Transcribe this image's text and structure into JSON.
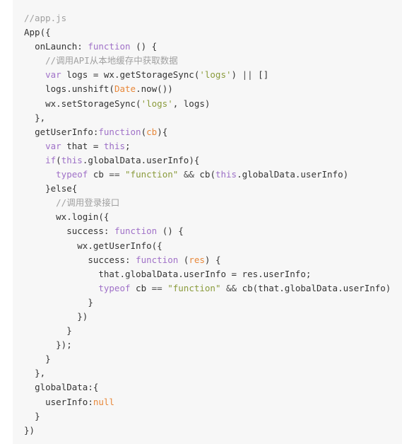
{
  "editor": {
    "language": "javascript",
    "file_name": "app.js",
    "background_color": "#f7f7f7",
    "page_background_color": "#ffffff",
    "default_text_color": "#333333",
    "colors": {
      "comment": "#a0a0a0",
      "keyword": "#a071c8",
      "this_keyword": "#9b6ec6",
      "parameter": "#e8883a",
      "builtin": "#e8883a",
      "string": "#8a9b3b",
      "null_literal": "#e8883a",
      "operator": "#4a4a4a"
    }
  },
  "code": {
    "plain_text": "//app.js\nApp({\n  onLaunch: function () {\n    //调用API从本地缓存中获取数据\n    var logs = wx.getStorageSync('logs') || []\n    logs.unshift(Date.now())\n    wx.setStorageSync('logs', logs)\n  },\n  getUserInfo:function(cb){\n    var that = this;\n    if(this.globalData.userInfo){\n      typeof cb == \"function\" && cb(this.globalData.userInfo)\n    }else{\n      //调用登录接口\n      wx.login({\n        success: function () {\n          wx.getUserInfo({\n            success: function (res) {\n              that.globalData.userInfo = res.userInfo;\n              typeof cb == \"function\" && cb(that.globalData.userInfo)\n            }\n          })\n        }\n      });\n    }\n  },\n  globalData:{\n    userInfo:null\n  }\n})",
    "lines": [
      {
        "indent": "",
        "tokens": [
          {
            "t": "//app.js",
            "c": "comment"
          }
        ]
      },
      {
        "indent": "",
        "tokens": [
          {
            "t": "App({",
            "c": "plain"
          }
        ]
      },
      {
        "indent": "  ",
        "tokens": [
          {
            "t": "onLaunch: ",
            "c": "plain"
          },
          {
            "t": "function",
            "c": "keyword"
          },
          {
            "t": " () {",
            "c": "plain"
          }
        ]
      },
      {
        "indent": "    ",
        "tokens": [
          {
            "t": "//调用API从本地缓存中获取数据",
            "c": "comment"
          }
        ]
      },
      {
        "indent": "    ",
        "tokens": [
          {
            "t": "var",
            "c": "keyword"
          },
          {
            "t": " logs = wx.getStorageSync(",
            "c": "plain"
          },
          {
            "t": "'logs'",
            "c": "string"
          },
          {
            "t": ") ",
            "c": "plain"
          },
          {
            "t": "||",
            "c": "op"
          },
          {
            "t": " []",
            "c": "plain"
          }
        ]
      },
      {
        "indent": "    ",
        "tokens": [
          {
            "t": "logs.unshift(",
            "c": "plain"
          },
          {
            "t": "Date",
            "c": "builtin"
          },
          {
            "t": ".now())",
            "c": "plain"
          }
        ]
      },
      {
        "indent": "    ",
        "tokens": [
          {
            "t": "wx.setStorageSync(",
            "c": "plain"
          },
          {
            "t": "'logs'",
            "c": "string"
          },
          {
            "t": ", logs)",
            "c": "plain"
          }
        ]
      },
      {
        "indent": "  ",
        "tokens": [
          {
            "t": "},",
            "c": "plain"
          }
        ]
      },
      {
        "indent": "  ",
        "tokens": [
          {
            "t": "getUserInfo:",
            "c": "plain"
          },
          {
            "t": "function",
            "c": "keyword"
          },
          {
            "t": "(",
            "c": "plain"
          },
          {
            "t": "cb",
            "c": "param"
          },
          {
            "t": "){",
            "c": "plain"
          }
        ]
      },
      {
        "indent": "    ",
        "tokens": [
          {
            "t": "var",
            "c": "keyword"
          },
          {
            "t": " that = ",
            "c": "plain"
          },
          {
            "t": "this",
            "c": "this"
          },
          {
            "t": ";",
            "c": "plain"
          }
        ]
      },
      {
        "indent": "    ",
        "tokens": [
          {
            "t": "if",
            "c": "keyword"
          },
          {
            "t": "(",
            "c": "plain"
          },
          {
            "t": "this",
            "c": "this"
          },
          {
            "t": ".globalData.userInfo){",
            "c": "plain"
          }
        ]
      },
      {
        "indent": "      ",
        "tokens": [
          {
            "t": "typeof",
            "c": "keyword"
          },
          {
            "t": " cb ",
            "c": "plain"
          },
          {
            "t": "==",
            "c": "op"
          },
          {
            "t": " ",
            "c": "plain"
          },
          {
            "t": "\"function\"",
            "c": "string"
          },
          {
            "t": " ",
            "c": "plain"
          },
          {
            "t": "&&",
            "c": "op"
          },
          {
            "t": " cb(",
            "c": "plain"
          },
          {
            "t": "this",
            "c": "this"
          },
          {
            "t": ".globalData.userInfo)",
            "c": "plain"
          }
        ]
      },
      {
        "indent": "    ",
        "tokens": [
          {
            "t": "}",
            "c": "plain"
          },
          {
            "t": "else",
            "c": "plain"
          },
          {
            "t": "{",
            "c": "plain"
          }
        ]
      },
      {
        "indent": "      ",
        "tokens": [
          {
            "t": "//调用登录接口",
            "c": "comment"
          }
        ]
      },
      {
        "indent": "      ",
        "tokens": [
          {
            "t": "wx.login({",
            "c": "plain"
          }
        ]
      },
      {
        "indent": "        ",
        "tokens": [
          {
            "t": "success: ",
            "c": "plain"
          },
          {
            "t": "function",
            "c": "keyword"
          },
          {
            "t": " () {",
            "c": "plain"
          }
        ]
      },
      {
        "indent": "          ",
        "tokens": [
          {
            "t": "wx.getUserInfo({",
            "c": "plain"
          }
        ]
      },
      {
        "indent": "            ",
        "tokens": [
          {
            "t": "success: ",
            "c": "plain"
          },
          {
            "t": "function",
            "c": "keyword"
          },
          {
            "t": " (",
            "c": "plain"
          },
          {
            "t": "res",
            "c": "param"
          },
          {
            "t": ") {",
            "c": "plain"
          }
        ]
      },
      {
        "indent": "              ",
        "tokens": [
          {
            "t": "that.globalData.userInfo = res.userInfo;",
            "c": "plain"
          }
        ]
      },
      {
        "indent": "              ",
        "tokens": [
          {
            "t": "typeof",
            "c": "keyword"
          },
          {
            "t": " cb ",
            "c": "plain"
          },
          {
            "t": "==",
            "c": "op"
          },
          {
            "t": " ",
            "c": "plain"
          },
          {
            "t": "\"function\"",
            "c": "string"
          },
          {
            "t": " ",
            "c": "plain"
          },
          {
            "t": "&&",
            "c": "op"
          },
          {
            "t": " cb(that.globalData.userInfo)",
            "c": "plain"
          }
        ]
      },
      {
        "indent": "            ",
        "tokens": [
          {
            "t": "}",
            "c": "plain"
          }
        ]
      },
      {
        "indent": "          ",
        "tokens": [
          {
            "t": "})",
            "c": "plain"
          }
        ]
      },
      {
        "indent": "        ",
        "tokens": [
          {
            "t": "}",
            "c": "plain"
          }
        ]
      },
      {
        "indent": "      ",
        "tokens": [
          {
            "t": "});",
            "c": "plain"
          }
        ]
      },
      {
        "indent": "    ",
        "tokens": [
          {
            "t": "}",
            "c": "plain"
          }
        ]
      },
      {
        "indent": "  ",
        "tokens": [
          {
            "t": "},",
            "c": "plain"
          }
        ]
      },
      {
        "indent": "  ",
        "tokens": [
          {
            "t": "globalData:{",
            "c": "plain"
          }
        ]
      },
      {
        "indent": "    ",
        "tokens": [
          {
            "t": "userInfo:",
            "c": "plain"
          },
          {
            "t": "null",
            "c": "null"
          }
        ]
      },
      {
        "indent": "  ",
        "tokens": [
          {
            "t": "}",
            "c": "plain"
          }
        ]
      },
      {
        "indent": "",
        "tokens": [
          {
            "t": "})",
            "c": "plain"
          }
        ]
      }
    ]
  }
}
